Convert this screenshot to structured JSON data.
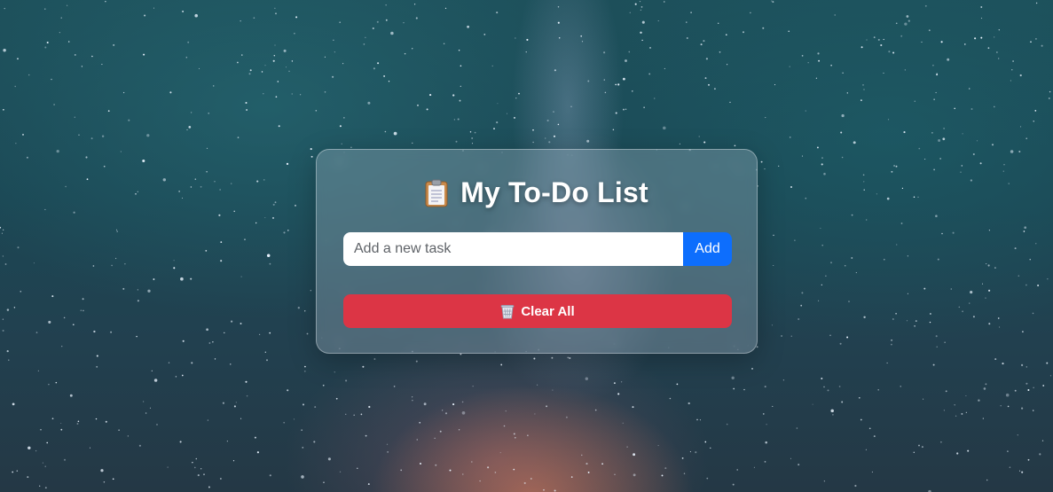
{
  "app": {
    "title": "My To-Do List",
    "title_icon": "clipboard-icon"
  },
  "input": {
    "placeholder": "Add a new task",
    "value": ""
  },
  "buttons": {
    "add_label": "Add",
    "clear_label": "Clear All",
    "clear_icon": "wastebasket-icon"
  },
  "tasks": [],
  "colors": {
    "add_button": "#0d6efd",
    "clear_button": "#dc3545",
    "title_text": "#ffffff"
  }
}
